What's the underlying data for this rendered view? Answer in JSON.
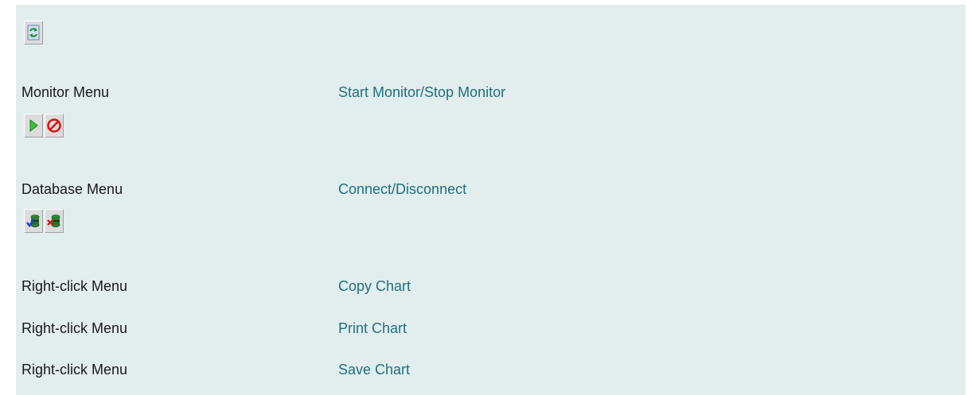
{
  "toolbar": {
    "refresh_icon": "refresh-icon"
  },
  "rows": [
    {
      "menu": "Monitor Menu",
      "action": "Start Monitor/Stop Monitor",
      "icons": [
        "start-monitor-icon",
        "stop-monitor-icon"
      ]
    },
    {
      "menu": "Database Menu",
      "action": "Connect/Disconnect",
      "icons": [
        "database-connect-icon",
        "database-disconnect-icon"
      ]
    },
    {
      "menu": "Right-click Menu",
      "action": "Copy Chart"
    },
    {
      "menu": "Right-click Menu",
      "action": "Print Chart"
    },
    {
      "menu": "Right-click Menu",
      "action": "Save Chart"
    }
  ],
  "colors": {
    "panel_bg": "#e2eded",
    "link": "#1f6f80",
    "text": "#1a1a1a"
  }
}
